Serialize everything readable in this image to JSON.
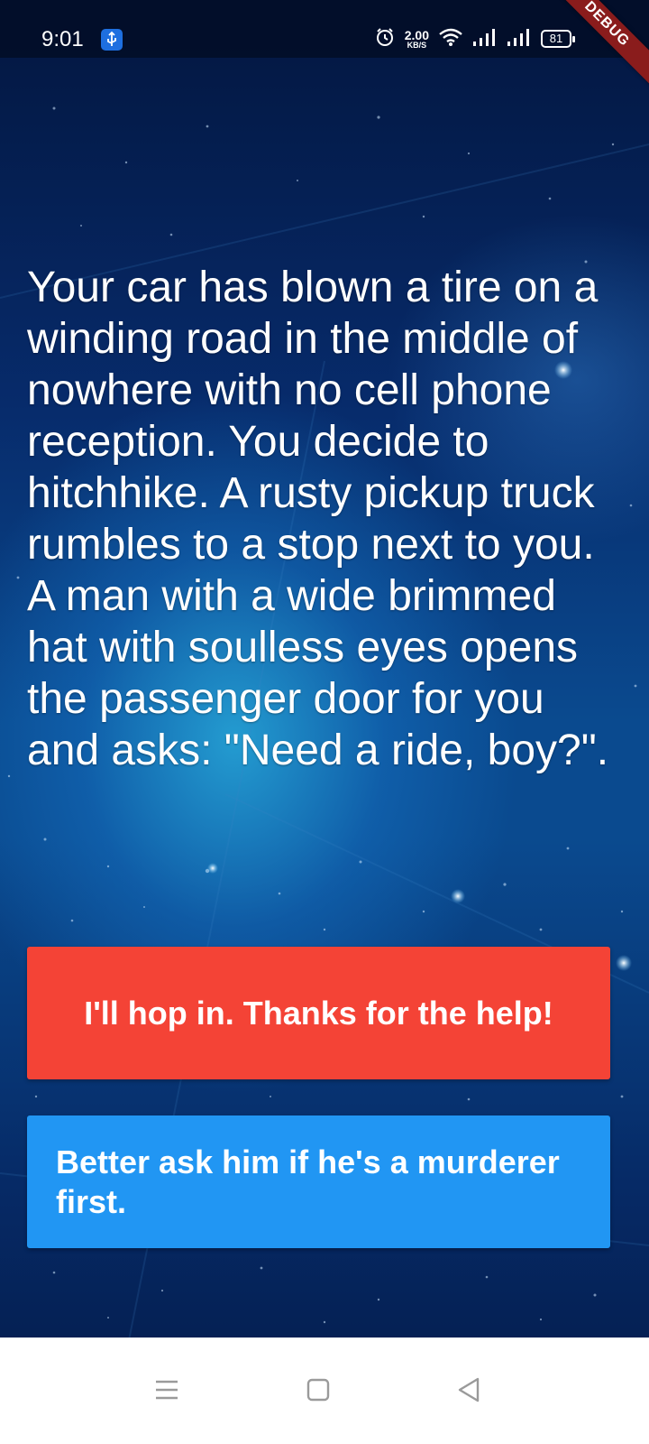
{
  "status_bar": {
    "time": "9:01",
    "net_speed_value": "2.00",
    "net_speed_unit": "KB/S",
    "battery_level": "81",
    "icons": [
      "usb-icon",
      "alarm-icon",
      "wifi-icon",
      "signal-icon",
      "signal-icon",
      "battery-icon"
    ]
  },
  "debug_banner": "DEBUG",
  "story": {
    "text": "Your car has blown a tire on a winding road in the middle of nowhere with no cell phone reception. You decide to hitchhike. A rusty pickup truck rumbles to a stop next to you. A man with a wide brimmed hat with soulless eyes opens the passenger door for you and asks: \"Need a ride, boy?\"."
  },
  "choices": [
    {
      "label": "I'll hop in. Thanks for the help!",
      "color": "#f44336"
    },
    {
      "label": "Better ask him if he's a murderer first.",
      "color": "#2196f3"
    }
  ],
  "nav_bar": {
    "buttons": [
      "menu-icon",
      "home-icon",
      "back-icon"
    ]
  }
}
